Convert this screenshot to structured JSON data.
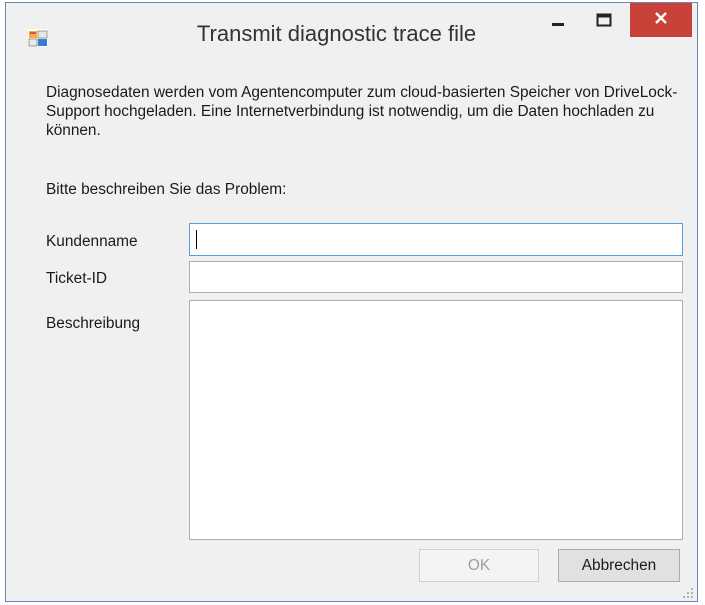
{
  "window": {
    "title": "Transmit diagnostic trace file",
    "app_icon": "form-icon",
    "controls": {
      "minimize": "minimize-icon",
      "maximize": "maximize-icon",
      "close": "close-icon"
    },
    "colors": {
      "close_button": "#c9423a",
      "frame": "#6b86b7",
      "background": "#f0f0f0"
    }
  },
  "content": {
    "description": "Diagnosedaten werden vom Agentencomputer zum cloud-basierten Speicher von DriveLock-Support hochgeladen. Eine Internetverbindung ist notwendig, um die Daten hochladen zu können.",
    "prompt": "Bitte beschreiben Sie das Problem:",
    "fields": {
      "customer_label": "Kundenname",
      "customer_value": "",
      "ticket_label": "Ticket-ID",
      "ticket_value": "",
      "description_label": "Beschreibung",
      "description_value": ""
    }
  },
  "buttons": {
    "ok": "OK",
    "cancel": "Abbrechen"
  }
}
